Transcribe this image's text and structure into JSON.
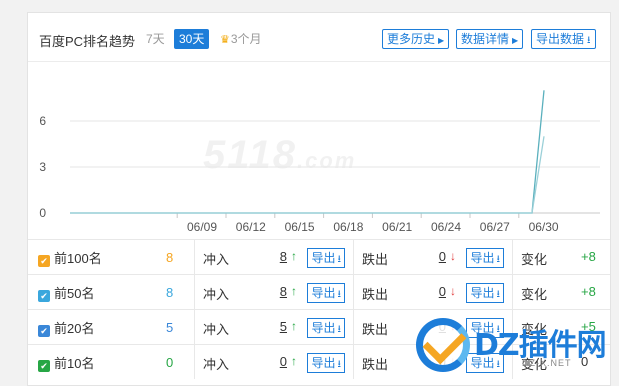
{
  "header": {
    "title": "百度PC排名趋势",
    "ranges": [
      "7天",
      "30天",
      "3个月"
    ],
    "buttons": {
      "history": "更多历史",
      "details": "数据详情",
      "export": "导出数据"
    }
  },
  "chart_data": {
    "type": "line",
    "title": "",
    "x_ticks": [
      "06/09",
      "06/12",
      "06/15",
      "06/18",
      "06/21",
      "06/24",
      "06/27",
      "06/30"
    ],
    "y_ticks": [
      0,
      3,
      6
    ],
    "ylim": [
      0,
      9
    ],
    "grid": true,
    "series": [
      {
        "color": "#5ab0bd",
        "values": [
          0,
          0,
          0,
          0,
          0,
          0,
          0,
          0,
          0,
          0,
          0,
          0,
          0,
          0,
          0,
          0,
          0,
          0,
          0,
          0,
          0,
          0,
          0,
          0,
          0,
          0,
          0,
          0,
          0,
          8
        ]
      },
      {
        "color": "#9bd0d8",
        "values": [
          0,
          0,
          0,
          0,
          0,
          0,
          0,
          0,
          0,
          0,
          0,
          0,
          0,
          0,
          0,
          0,
          0,
          0,
          0,
          0,
          0,
          0,
          0,
          0,
          0,
          0,
          0,
          0,
          0,
          5
        ]
      }
    ]
  },
  "watermark": {
    "text": "5118",
    "domain": ".com"
  },
  "rows": [
    {
      "name": "前100名",
      "color": "#f5a623",
      "count": "8",
      "count_color": "#f5a623",
      "rush_label": "冲入",
      "rush": "8",
      "rush_dir": "up",
      "drop_label": "跌出",
      "drop": "0",
      "drop_dir": "down",
      "export": "导出",
      "change_label": "变化",
      "change": "+8"
    },
    {
      "name": "前50名",
      "color": "#3aa7dd",
      "count": "8",
      "count_color": "#3aa7dd",
      "rush_label": "冲入",
      "rush": "8",
      "rush_dir": "up",
      "drop_label": "跌出",
      "drop": "0",
      "drop_dir": "down",
      "export": "导出",
      "change_label": "变化",
      "change": "+8"
    },
    {
      "name": "前20名",
      "color": "#3a87d8",
      "count": "5",
      "count_color": "#3a87d8",
      "rush_label": "冲入",
      "rush": "5",
      "rush_dir": "up",
      "drop_label": "跌出",
      "drop": "0",
      "drop_dir": "down",
      "export": "导出",
      "change_label": "变化",
      "change": "+5"
    },
    {
      "name": "前10名",
      "color": "#27a645",
      "count": "0",
      "count_color": "#27a645",
      "rush_label": "冲入",
      "rush": "0",
      "rush_dir": "up",
      "drop_label": "跌出",
      "drop": "0",
      "drop_dir": "down",
      "export": "导出",
      "change_label": "变化",
      "change": "0"
    }
  ],
  "logo": {
    "text": "DZ插件网",
    "sub": "DZ-X.NET"
  }
}
